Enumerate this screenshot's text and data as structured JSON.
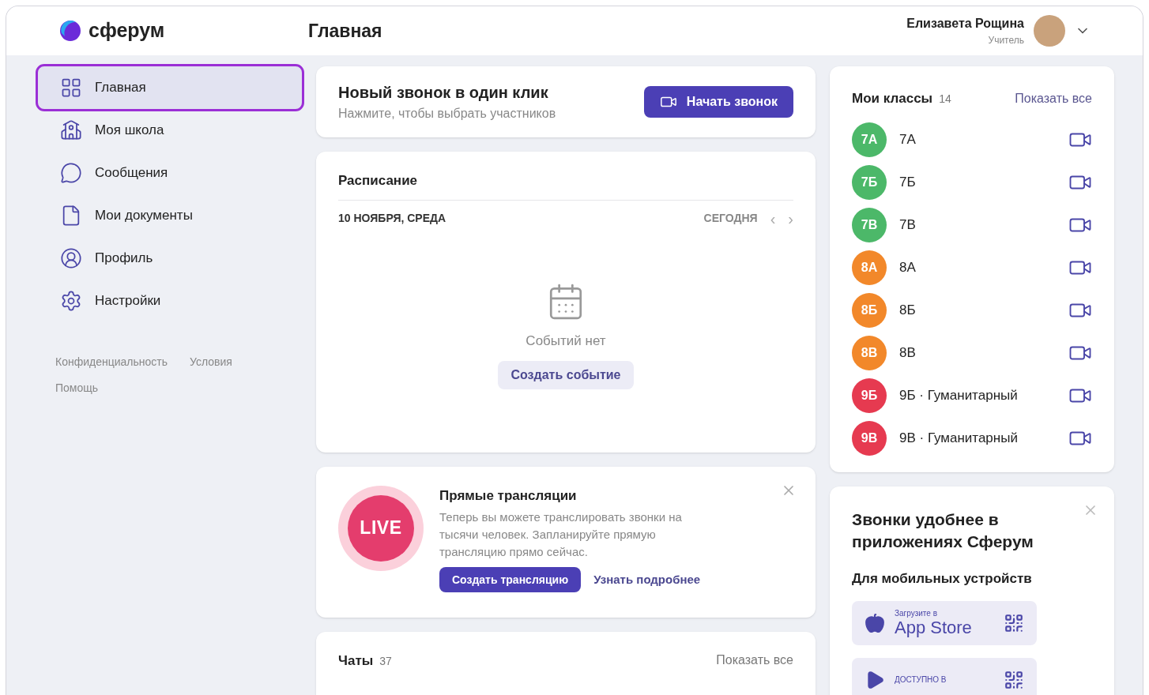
{
  "header": {
    "logo": "сферум",
    "title": "Главная",
    "user": {
      "name": "Елизавета Рощина",
      "role": "Учитель"
    }
  },
  "sidebar": {
    "items": [
      {
        "label": "Главная",
        "kind": "grid",
        "selected": true
      },
      {
        "label": "Моя школа",
        "kind": "school",
        "selected": false
      },
      {
        "label": "Сообщения",
        "kind": "chat",
        "selected": false
      },
      {
        "label": "Мои документы",
        "kind": "doc",
        "selected": false
      },
      {
        "label": "Профиль",
        "kind": "profile",
        "selected": false
      },
      {
        "label": "Настройки",
        "kind": "settings",
        "selected": false
      }
    ],
    "footer_links": [
      "Конфиденциальность",
      "Условия",
      "Помощь"
    ]
  },
  "call_card": {
    "title": "Новый звонок в один клик",
    "subtitle": "Нажмите, чтобы выбрать участников",
    "button": "Начать звонок"
  },
  "schedule": {
    "title": "Расписание",
    "date": "10 НОЯБРЯ, СРЕДА",
    "today": "СЕГОДНЯ",
    "prev": "‹",
    "next": "›",
    "empty": "Событий нет",
    "button": "Создать событие"
  },
  "live": {
    "badge": "LIVE",
    "title": "Прямые трансляции",
    "text": "Теперь вы можете транслировать звонки на тысячи человек. Запланируйте прямую трансляцию прямо сейчас.",
    "button": "Создать трансляцию",
    "link": "Узнать подробнее"
  },
  "chats": {
    "title": "Чаты",
    "count": "37",
    "link": "Показать все"
  },
  "classes": {
    "title": "Мои классы",
    "count": "14",
    "link": "Показать все",
    "items": [
      {
        "badge": "7А",
        "name": "7А",
        "color": "#4cb869"
      },
      {
        "badge": "7Б",
        "name": "7Б",
        "color": "#4cb869"
      },
      {
        "badge": "7В",
        "name": "7В",
        "color": "#4cb869"
      },
      {
        "badge": "8А",
        "name": "8А",
        "color": "#f2882a"
      },
      {
        "badge": "8Б",
        "name": "8Б",
        "color": "#f2882a"
      },
      {
        "badge": "8В",
        "name": "8В",
        "color": "#f2882a"
      },
      {
        "badge": "9Б",
        "name": "9Б · Гуманитарный",
        "color": "#e63a50"
      },
      {
        "badge": "9В",
        "name": "9В · Гуманитарный",
        "color": "#e63a50"
      }
    ]
  },
  "apps": {
    "title": "Звонки удобнее в приложениях Сферум",
    "subtitle": "Для мобильных устройств",
    "stores": [
      {
        "kind": "apple",
        "caption": "Загрузите в",
        "name": "App Store"
      },
      {
        "kind": "google",
        "caption": "ДОСТУПНО В"
      }
    ]
  }
}
